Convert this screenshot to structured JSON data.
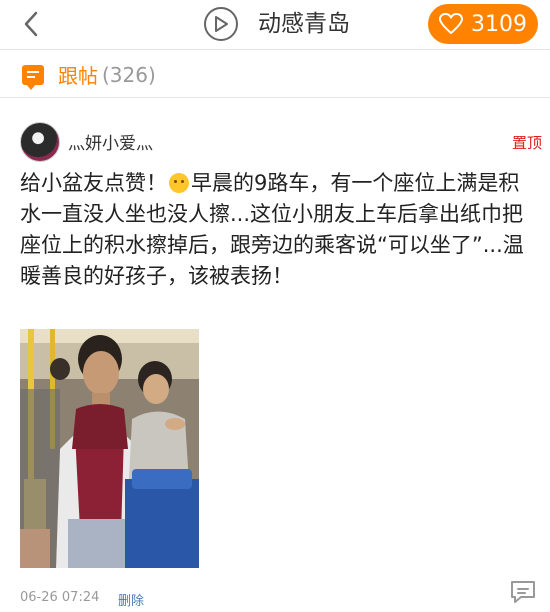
{
  "header": {
    "back_icon": "chevron-left-icon",
    "play_icon": "play-circle-icon",
    "title": "动感青岛",
    "like_icon": "heart-icon",
    "like_count": "3109",
    "accent": "#ff8200"
  },
  "section": {
    "icon": "comment-bubble-icon",
    "label": "跟帖",
    "count": "(326)"
  },
  "post": {
    "username": "灬妍小爱灬",
    "pin_label": "置顶",
    "text_before_emoji": "给小盆友点赞！",
    "emoji": "grin-emoji",
    "text_after_emoji": "早晨的9路车，有一个座位上满是积水一直没人坐也没人擦...这位小朋友上车后拿出纸巾把座位上的积水擦掉后，跟旁边的乘客说“可以坐了”...温暖善良的好孩子，该被表扬！",
    "time": "06-26 07:24",
    "delete_label": "删除",
    "comment_icon": "comment-icon",
    "pin_color": "#e02020",
    "link_color": "#4a7ab8"
  }
}
